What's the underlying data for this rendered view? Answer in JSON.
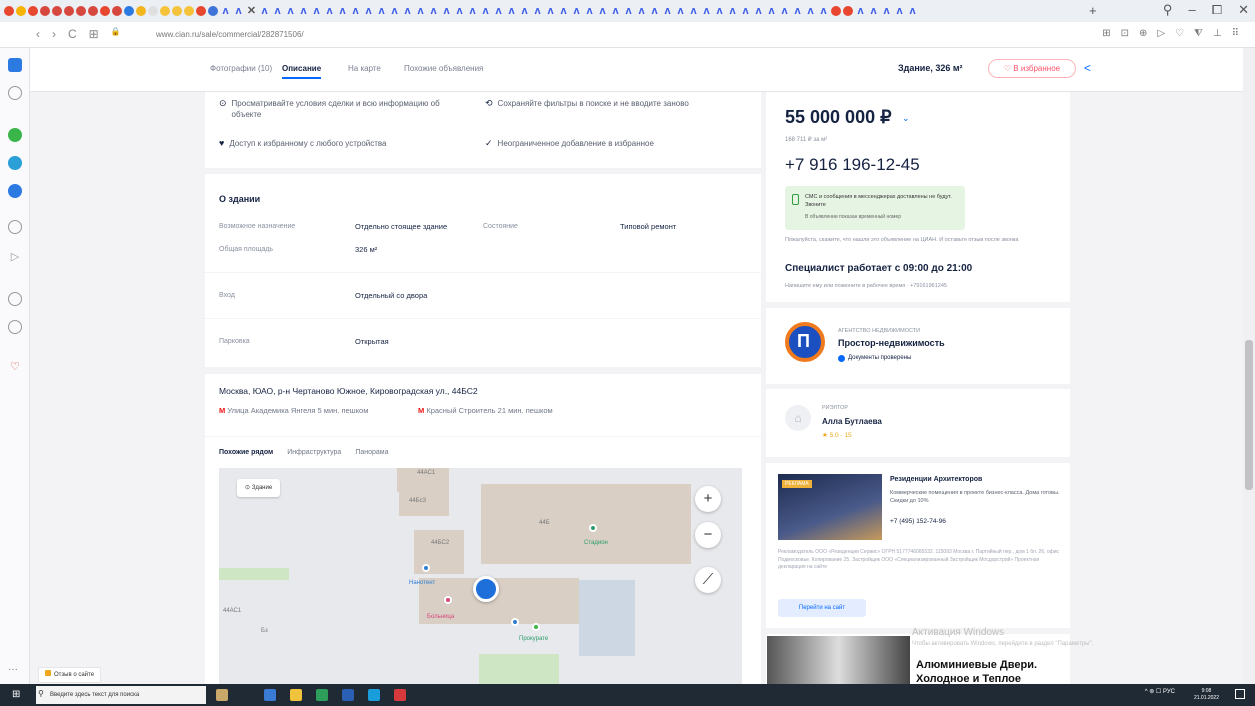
{
  "browser": {
    "url": "www.cian.ru/sale/commercial/282871506/",
    "nav": {
      "back": "‹",
      "forward": "›",
      "reload": "C",
      "apps": "⊞",
      "lock": "🔒"
    },
    "tab_plus": "+",
    "window_controls": {
      "search": "⚲",
      "minimize": "–",
      "maximize": "⧠",
      "close": "✕"
    },
    "toolbar_icons": [
      "⊞",
      "⊡",
      "⊕",
      "▷",
      "♡",
      "⧨",
      "⊥",
      "⠿"
    ]
  },
  "topnav": {
    "tabs": [
      "Фотографии (10)",
      "Описание",
      "На карте",
      "Похожие объявления"
    ],
    "active_tab": 1,
    "summary": "Здание, 326 м²",
    "favorite_button": "♡ В избранное",
    "share_icon": "<"
  },
  "benefits": [
    {
      "icon": "⊙",
      "text": "Просматривайте условия сделки и всю информацию об объекте"
    },
    {
      "icon": "⟲",
      "text": "Сохраняйте фильтры в поиске и не вводите заново"
    },
    {
      "icon": "♥",
      "text": "Доступ к избранному с любого устройства"
    },
    {
      "icon": "✓",
      "text": "Неограниченное добавление в избранное"
    }
  ],
  "building": {
    "heading": "О здании",
    "purpose_label": "Возможное назначение",
    "purpose_value": "Отдельно стоящее здание",
    "state_label": "Состояние",
    "state_value": "Типовой ремонт",
    "area_label": "Общая площадь",
    "area_value": "326 м²",
    "entrance_label": "Вход",
    "entrance_value": "Отдельный со двора",
    "parking_label": "Парковка",
    "parking_value": "Открытая"
  },
  "location": {
    "address": "Москва, ЮАО, р-н Чертаново Южное, Кировоградская ул., 44БС2",
    "metro": [
      {
        "icon": "M",
        "name": "Улица Академика Янгеля",
        "time": "5 мин. пешком"
      },
      {
        "icon": "M",
        "name": "Красный Строитель",
        "time": "21 мин. пешком"
      }
    ],
    "map_tabs": [
      "Похожие рядом",
      "Инфраструктура",
      "Панорама"
    ],
    "map_selector": "⊙ Здание",
    "map_labels": [
      "44АС1",
      "44Бс3",
      "44БС2",
      "44Б",
      "Стадион",
      "Нанотент",
      "Больница",
      "Прокурате",
      "44АС1",
      "Бз",
      "Школа 1"
    ],
    "map_controls": {
      "zoom_in": "+",
      "zoom_out": "−",
      "ruler": "⟋"
    }
  },
  "price": {
    "value": "55 000 000 ₽",
    "per_meter": "168 711 ₽ за м²",
    "phone": "+7 916 196-12-45",
    "sms_text": "СМС и сообщения в мессенджерах доставлены не будут. Звоните",
    "sms_sub": "В объявлении показан временный номер",
    "note": "Пожалуйста, скажите, что нашли это объявление на ЦИАН. И оставьте отзыв после звонка",
    "working_hours": "Специалист работает с 09:00 до 21:00",
    "call_hint": "Напишите ему или позвоните в рабочее время · +79161961245"
  },
  "agency": {
    "label": "АГЕНТСТВО НЕДВИЖИМОСТИ",
    "name": "Простор-недвижимость",
    "verified": "Документы проверены",
    "logo": "П"
  },
  "agent": {
    "label": "РИЭЛТОР",
    "name": "Алла Бутлаева",
    "rating": "★ 5.0 · 15"
  },
  "ad": {
    "tag": "РЕКЛАМА",
    "title": "Резиденции Архитекторов",
    "desc": "Коммерческие помещения в проекте бизнес-класса. Дома готовы. Скидки до 10%",
    "phone": "+7 (495) 152-74-96",
    "legal": "Рекламодатель ООО «Резиденции Сервис» ОГРН 5177746065532. 115093 Москва г. Партийный пер., дом 1 бл. 26, офис Подмосковье. Копирование 25. Застройщик ООО «Специализированный Застройщик Мосдорстрой» Проектная декларация на сайте",
    "button": "Перейти на сайт"
  },
  "ad2": {
    "title": "Алюминиевые Двери. Холодное и Теплое"
  },
  "activation": {
    "title": "Активация Windows",
    "sub": "Чтобы активировать Windows, перейдите в раздел \"Параметры\"."
  },
  "feedback": "Отзыв о сайте",
  "taskbar": {
    "search_placeholder": "Введите здесь текст для поиска",
    "tray": "^ ⊚ ☐ РУС",
    "time": "9:08",
    "date": "21.01.2022"
  },
  "colors": {
    "accent": "#0468ff",
    "brand_text": "#152242",
    "fav": "#ff5369"
  }
}
